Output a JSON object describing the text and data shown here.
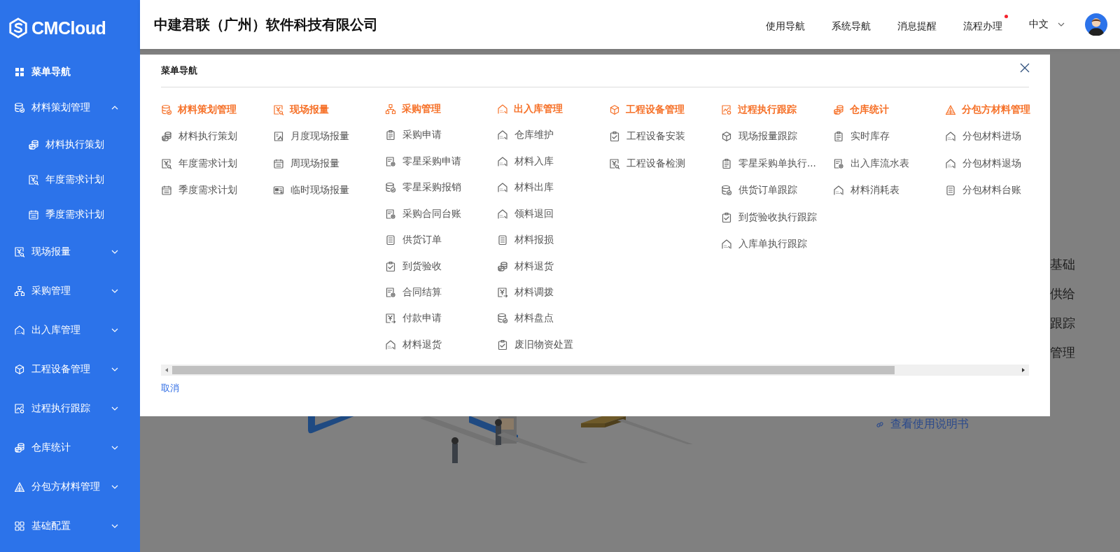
{
  "logo": {
    "text": "CMCloud"
  },
  "header": {
    "company": "中建君联（广州）软件科技有限公司",
    "nav": [
      {
        "label": "使用导航",
        "badge": false
      },
      {
        "label": "系统导航",
        "badge": false
      },
      {
        "label": "消息提醒",
        "badge": false
      },
      {
        "label": "流程办理",
        "badge": true
      }
    ],
    "language": "中文"
  },
  "sidebar": {
    "home": "菜单导航",
    "groups": [
      {
        "label": "材料策划管理",
        "expanded": true,
        "children": [
          {
            "label": "材料执行策划"
          },
          {
            "label": "年度需求计划"
          },
          {
            "label": "季度需求计划"
          }
        ]
      },
      {
        "label": "现场报量",
        "expanded": false
      },
      {
        "label": "采购管理",
        "expanded": false
      },
      {
        "label": "出入库管理",
        "expanded": false
      },
      {
        "label": "工程设备管理",
        "expanded": false
      },
      {
        "label": "过程执行跟踪",
        "expanded": false
      },
      {
        "label": "仓库统计",
        "expanded": false
      },
      {
        "label": "分包方材料管理",
        "expanded": false
      },
      {
        "label": "基础配置",
        "expanded": false
      }
    ]
  },
  "menu_panel": {
    "title": "菜单导航",
    "columns": [
      {
        "title": "材料策划管理",
        "items": [
          "材料执行策划",
          "年度需求计划",
          "季度需求计划"
        ]
      },
      {
        "title": "现场报量",
        "items": [
          "月度现场报量",
          "周现场报量",
          "临时现场报量"
        ]
      },
      {
        "title": "采购管理",
        "items": [
          "采购申请",
          "零星采购申请",
          "零星采购报销",
          "采购合同台账",
          "供货订单",
          "到货验收",
          "合同结算",
          "付款申请",
          "材料退货"
        ]
      },
      {
        "title": "出入库管理",
        "items": [
          "仓库维护",
          "材料入库",
          "材料出库",
          "领料退回",
          "材料报损",
          "材料退货",
          "材料调拨",
          "材料盘点",
          "废旧物资处置"
        ]
      },
      {
        "title": "工程设备管理",
        "items": [
          "工程设备安装",
          "工程设备检测"
        ]
      },
      {
        "title": "过程执行跟踪",
        "items": [
          "现场报量跟踪",
          "零星采购单执行...",
          "供货订单跟踪",
          "到货验收执行跟踪",
          "入库单执行跟踪"
        ]
      },
      {
        "title": "仓库统计",
        "items": [
          "实时库存",
          "出入库流水表",
          "材料消耗表"
        ]
      },
      {
        "title": "分包方材料管理",
        "items": [
          "分包材料进场",
          "分包材料退场",
          "分包材料台账"
        ]
      }
    ],
    "cancel": "取消"
  },
  "background_page": {
    "lines": [
      "基础",
      "供给",
      "跟踪",
      "管理"
    ],
    "link": "查看使用说明书",
    "picture": {
      "kind": "picture"
    }
  }
}
